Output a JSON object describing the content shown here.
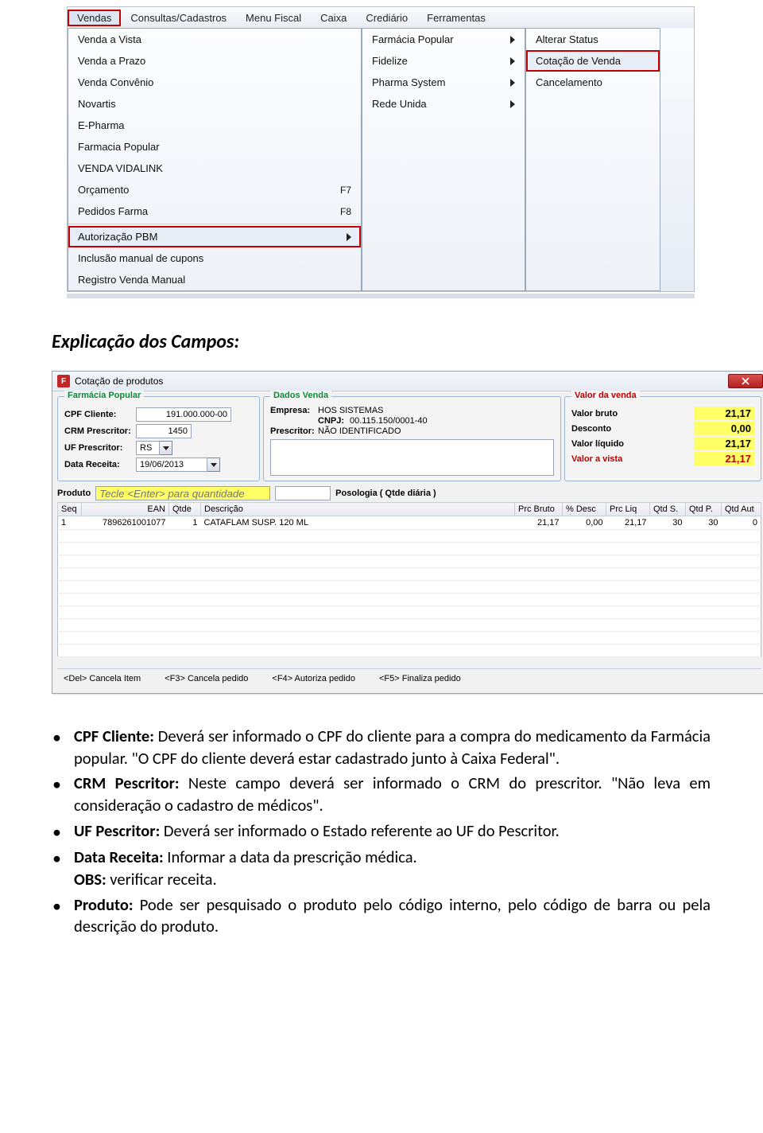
{
  "menubar": {
    "items": [
      "Vendas",
      "Consultas/Cadastros",
      "Menu Fiscal",
      "Caixa",
      "Crediário",
      "Ferramentas"
    ],
    "selected_index": 0
  },
  "dropdown1": {
    "items": [
      {
        "label": "Venda a Vista",
        "shortcut": "",
        "submenu": false
      },
      {
        "label": "Venda a Prazo",
        "shortcut": "",
        "submenu": false
      },
      {
        "label": "Venda Convênio",
        "shortcut": "",
        "submenu": false
      },
      {
        "label": "Novartis",
        "shortcut": "",
        "submenu": false
      },
      {
        "label": "E-Pharma",
        "shortcut": "",
        "submenu": false
      },
      {
        "label": "Farmacia Popular",
        "shortcut": "",
        "submenu": false
      },
      {
        "label": "VENDA VIDALINK",
        "shortcut": "",
        "submenu": false
      },
      {
        "label": "Orçamento",
        "shortcut": "F7",
        "submenu": false
      },
      {
        "label": "Pedidos Farma",
        "shortcut": "F8",
        "submenu": false
      }
    ],
    "items2": [
      {
        "label": "Autorização PBM",
        "submenu": true,
        "highlight": true
      },
      {
        "label": "Inclusão manual de cupons",
        "submenu": false
      },
      {
        "label": "Registro Venda Manual",
        "submenu": false
      }
    ]
  },
  "dropdown2": {
    "items": [
      {
        "label": "Farmácia Popular",
        "submenu": true
      },
      {
        "label": "Fidelize",
        "submenu": true
      },
      {
        "label": "Pharma System",
        "submenu": true
      },
      {
        "label": "Rede Unida",
        "submenu": true
      }
    ]
  },
  "dropdown3": {
    "items": [
      {
        "label": "Alterar Status",
        "highlight": false
      },
      {
        "label": "Cotação de Venda",
        "highlight": true
      },
      {
        "label": "Cancelamento",
        "highlight": false
      }
    ]
  },
  "section_heading": "Explicação dos Campos:",
  "dialog": {
    "title": "Cotação de produtos",
    "app_icon_text": "F",
    "group_fp": {
      "legend": "Farmácia Popular",
      "cpf_label": "CPF Cliente:",
      "cpf_value": "191.000.000-00",
      "crm_label": "CRM Prescritor:",
      "crm_value": "1450",
      "uf_label": "UF Prescritor:",
      "uf_value": "RS",
      "data_label": "Data Receita:",
      "data_value": "19/06/2013"
    },
    "group_dv": {
      "legend": "Dados Venda",
      "empresa_label": "Empresa:",
      "empresa_value": "HOS SISTEMAS",
      "cnpj_label": "CNPJ:",
      "cnpj_value": "00.115.150/0001-40",
      "prescritor_label": "Prescritor:",
      "prescritor_value": "NÃO IDENTIFICADO"
    },
    "group_vv": {
      "legend": "Valor da venda",
      "bruto_label": "Valor bruto",
      "bruto_value": "21,17",
      "desc_label": "Desconto",
      "desc_value": "0,00",
      "liq_label": "Valor líquido",
      "liq_value": "21,17",
      "avista_label": "Valor a vista",
      "avista_value": "21,17"
    },
    "produto_label": "Produto",
    "produto_placeholder": "Tecle <Enter> para quantidade",
    "posologia_label": "Posologia ( Qtde diária )",
    "grid": {
      "headers": [
        "Seq",
        "EAN",
        "Qtde",
        "Descrição",
        "Prc Bruto",
        "% Desc",
        "Prc Liq",
        "Qtd S.",
        "Qtd P.",
        "Qtd Aut"
      ],
      "row": {
        "seq": "1",
        "ean": "7896261001077",
        "qtde": "1",
        "desc": "CATAFLAM SUSP. 120 ML",
        "prc_bruto": "21,17",
        "pct_desc": "0,00",
        "prc_liq": "21,17",
        "qtd_s": "30",
        "qtd_p": "30",
        "qtd_aut": "0"
      }
    },
    "footer": {
      "f_del": "<Del> Cancela Item",
      "f_f3": "<F3> Cancela pedido",
      "f_f4": "<F4> Autoriza pedido",
      "f_f5": "<F5> Finaliza pedido"
    }
  },
  "bullets": {
    "b1_strong": "CPF Cliente:",
    "b1_text": " Deverá ser informado o CPF do cliente para a compra do medicamento da Farmácia popular. \"O CPF do cliente deverá estar cadastrado junto à Caixa Federal\".",
    "b2_strong": "CRM Pescritor:",
    "b2_text": " Neste campo deverá ser informado o CRM do prescritor. \"Não leva em consideração o cadastro de médicos\".",
    "b3_strong": "UF Pescritor:",
    "b3_text": " Deverá ser informado o Estado referente ao UF do Pescritor.",
    "b4_strong": "Data Receita:",
    "b4_text": " Informar a data da prescrição médica.",
    "obs_strong": "OBS:",
    "obs_text": " verificar receita.",
    "b5_strong": "Produto:",
    "b5_text": " Pode ser pesquisado o produto pelo código interno, pelo código de barra ou pela descrição do produto."
  }
}
